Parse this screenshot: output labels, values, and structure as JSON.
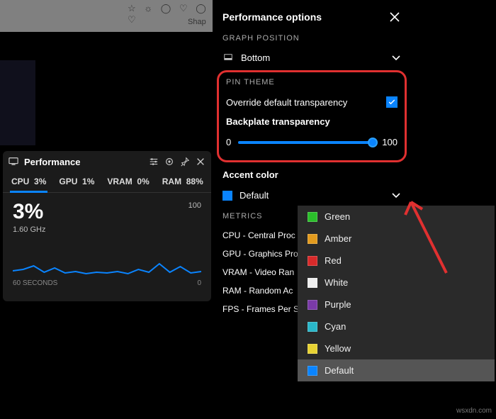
{
  "bg": {
    "shape_label": "Shap"
  },
  "perf_widget": {
    "title": "Performance",
    "tabs": [
      {
        "label": "CPU",
        "value": "3%"
      },
      {
        "label": "GPU",
        "value": "1%"
      },
      {
        "label": "VRAM",
        "value": "0%"
      },
      {
        "label": "RAM",
        "value": "88%"
      }
    ],
    "big_value": "3%",
    "sub_value": "1.60 GHz",
    "y_max": "100",
    "y_min": "0",
    "x_label": "60 SECONDS"
  },
  "panel": {
    "title": "Performance options",
    "graph_position": {
      "section": "GRAPH POSITION",
      "value": "Bottom"
    },
    "pin_theme": {
      "section": "PIN THEME",
      "override_label": "Override default transparency",
      "override_checked": true,
      "backplate_label": "Backplate transparency",
      "slider_min": "0",
      "slider_max": "100",
      "slider_value": 100
    },
    "accent": {
      "section": "Accent color",
      "value": "Default",
      "swatch": "#0a84ff"
    },
    "metrics": {
      "section": "METRICS",
      "items": [
        "CPU - Central Proc",
        "GPU - Graphics Pro",
        "VRAM - Video Ran",
        "RAM - Random Ac",
        "FPS - Frames Per S"
      ]
    }
  },
  "dropdown": {
    "options": [
      {
        "label": "Green",
        "color": "#2bbf2b"
      },
      {
        "label": "Amber",
        "color": "#e39b1e"
      },
      {
        "label": "Red",
        "color": "#d82a2a"
      },
      {
        "label": "White",
        "color": "#eeeeee"
      },
      {
        "label": "Purple",
        "color": "#7a3aa8"
      },
      {
        "label": "Cyan",
        "color": "#2ab7c9"
      },
      {
        "label": "Yellow",
        "color": "#e7d233"
      },
      {
        "label": "Default",
        "color": "#0a84ff",
        "selected": true
      }
    ]
  },
  "watermark": "wsxdn.com"
}
